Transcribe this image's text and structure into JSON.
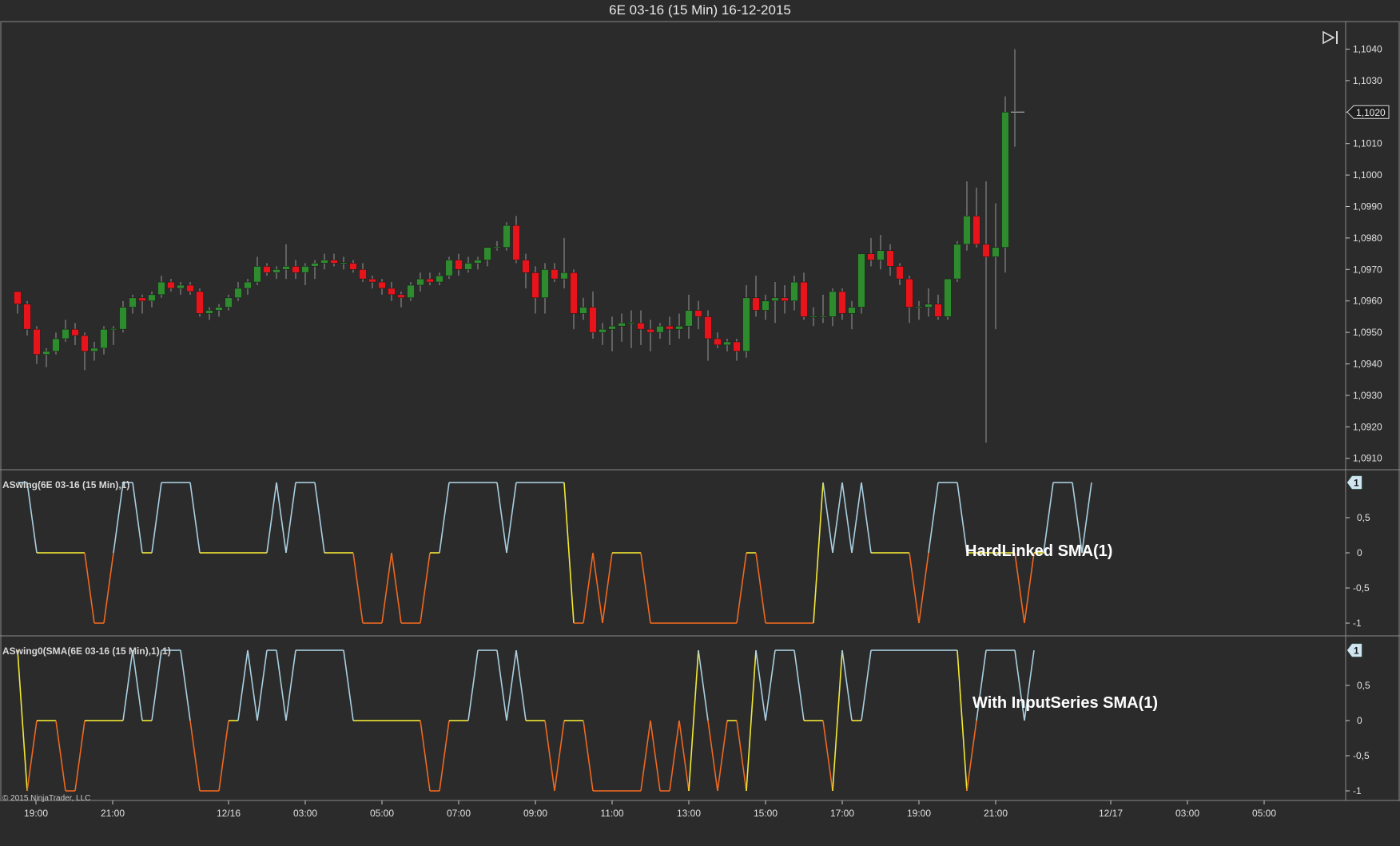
{
  "window": {
    "title": "6E 03-16 (15 Min)  16-12-2015"
  },
  "toolbar": {
    "goto_end_icon": "skip-to-end-icon"
  },
  "copyright": "© 2015 NinjaTrader, LLC",
  "colors": {
    "background": "#2b2b2b",
    "up": "#2e8b2e",
    "down": "#e8141b",
    "swing_high": "#a9cfe0",
    "swing_mid": "#f2e935",
    "swing_low": "#ee6820",
    "gridline": "#6e6e6e"
  },
  "time_axis": {
    "labels": [
      "19:00",
      "21:00",
      "12/16",
      "03:00",
      "05:00",
      "07:00",
      "09:00",
      "11:00",
      "13:00",
      "15:00",
      "17:00",
      "19:00",
      "21:00",
      "12/17",
      "03:00",
      "05:00"
    ]
  },
  "chart_data": [
    {
      "type": "candlestick",
      "title": "6E 03-16 (15 Min)  16-12-2015",
      "ylabel": "",
      "ylim": [
        1.0905,
        1.1045
      ],
      "y_ticks": [
        "1,0910",
        "1,0920",
        "1,0930",
        "1,0940",
        "1,0950",
        "1,0960",
        "1,0970",
        "1,0980",
        "1,0990",
        "1,1000",
        "1,1010",
        "1,1020",
        "1,1030",
        "1,1040"
      ],
      "last_price_label": "1,1020",
      "candles": [
        [
          1.0963,
          1.0963,
          1.0956,
          1.0959
        ],
        [
          1.0959,
          1.096,
          1.0949,
          1.0951
        ],
        [
          1.0951,
          1.0952,
          1.094,
          1.0943
        ],
        [
          1.0943,
          1.0945,
          1.0939,
          1.0944
        ],
        [
          1.0944,
          1.095,
          1.0943,
          1.0948
        ],
        [
          1.0948,
          1.0954,
          1.0947,
          1.0951
        ],
        [
          1.0951,
          1.0953,
          1.0946,
          1.0949
        ],
        [
          1.0949,
          1.095,
          1.0938,
          1.0944
        ],
        [
          1.0944,
          1.0947,
          1.0941,
          1.0945
        ],
        [
          1.0945,
          1.0952,
          1.0943,
          1.0951
        ],
        [
          1.0951,
          1.0952,
          1.0946,
          1.0951
        ],
        [
          1.0951,
          1.096,
          1.095,
          1.0958
        ],
        [
          1.0958,
          1.0962,
          1.0956,
          1.0961
        ],
        [
          1.0961,
          1.0962,
          1.0956,
          1.096
        ],
        [
          1.096,
          1.0963,
          1.0958,
          1.0962
        ],
        [
          1.0962,
          1.0968,
          1.0961,
          1.0966
        ],
        [
          1.0966,
          1.0967,
          1.0963,
          1.0964
        ],
        [
          1.0964,
          1.0966,
          1.0962,
          1.0965
        ],
        [
          1.0965,
          1.0966,
          1.0962,
          1.0963
        ],
        [
          1.0963,
          1.0964,
          1.0955,
          1.0956
        ],
        [
          1.0956,
          1.0958,
          1.0954,
          1.0957
        ],
        [
          1.0957,
          1.0959,
          1.0955,
          1.0958
        ],
        [
          1.0958,
          1.0962,
          1.0957,
          1.0961
        ],
        [
          1.0961,
          1.0966,
          1.096,
          1.0964
        ],
        [
          1.0964,
          1.0967,
          1.0962,
          1.0966
        ],
        [
          1.0966,
          1.0974,
          1.0965,
          1.0971
        ],
        [
          1.0971,
          1.0972,
          1.0968,
          1.0969
        ],
        [
          1.0969,
          1.0971,
          1.0967,
          1.097
        ],
        [
          1.097,
          1.0978,
          1.0967,
          1.0971
        ],
        [
          1.0971,
          1.0973,
          1.0967,
          1.0969
        ],
        [
          1.0969,
          1.0972,
          1.0965,
          1.0971
        ],
        [
          1.0971,
          1.0973,
          1.0967,
          1.0972
        ],
        [
          1.0972,
          1.0975,
          1.097,
          1.0973
        ],
        [
          1.0973,
          1.0975,
          1.0971,
          1.0972
        ],
        [
          1.0972,
          1.0974,
          1.097,
          1.0972
        ],
        [
          1.0972,
          1.0973,
          1.0969,
          1.097
        ],
        [
          1.097,
          1.0972,
          1.0966,
          1.0967
        ],
        [
          1.0967,
          1.0968,
          1.0964,
          1.0966
        ],
        [
          1.0966,
          1.0967,
          1.0962,
          1.0964
        ],
        [
          1.0964,
          1.0966,
          1.096,
          1.0962
        ],
        [
          1.0962,
          1.0963,
          1.0958,
          1.0961
        ],
        [
          1.0961,
          1.0966,
          1.096,
          1.0965
        ],
        [
          1.0965,
          1.0969,
          1.0963,
          1.0967
        ],
        [
          1.0967,
          1.0969,
          1.0965,
          1.0966
        ],
        [
          1.0966,
          1.0969,
          1.0965,
          1.0968
        ],
        [
          1.0968,
          1.0974,
          1.0967,
          1.0973
        ],
        [
          1.0973,
          1.0975,
          1.0968,
          1.097
        ],
        [
          1.097,
          1.0974,
          1.0969,
          1.0972
        ],
        [
          1.0972,
          1.0974,
          1.097,
          1.0973
        ],
        [
          1.0973,
          1.0976,
          1.0971,
          1.0977
        ],
        [
          1.0977,
          1.0979,
          1.0976,
          1.0977
        ],
        [
          1.0977,
          1.0985,
          1.0976,
          1.0984
        ],
        [
          1.0984,
          1.0987,
          1.0972,
          1.0973
        ],
        [
          1.0973,
          1.0975,
          1.0964,
          1.0969
        ],
        [
          1.0969,
          1.0971,
          1.0956,
          1.0961
        ],
        [
          1.0961,
          1.0972,
          1.0956,
          1.097
        ],
        [
          1.097,
          1.0972,
          1.0966,
          1.0967
        ],
        [
          1.0967,
          1.098,
          1.0964,
          1.0969
        ],
        [
          1.0969,
          1.097,
          1.0951,
          1.0956
        ],
        [
          1.0956,
          1.0961,
          1.0954,
          1.0958
        ],
        [
          1.0958,
          1.0963,
          1.0948,
          1.095
        ],
        [
          1.095,
          1.0953,
          1.0946,
          1.0951
        ],
        [
          1.0951,
          1.0955,
          1.0944,
          1.0952
        ],
        [
          1.0952,
          1.0956,
          1.0947,
          1.0953
        ],
        [
          1.0953,
          1.0957,
          1.0945,
          1.0953
        ],
        [
          1.0953,
          1.0957,
          1.0946,
          1.0951
        ],
        [
          1.0951,
          1.0954,
          1.0944,
          1.095
        ],
        [
          1.095,
          1.0953,
          1.0948,
          1.0952
        ],
        [
          1.0952,
          1.0955,
          1.0946,
          1.0951
        ],
        [
          1.0951,
          1.0956,
          1.0948,
          1.0952
        ],
        [
          1.0952,
          1.0962,
          1.0948,
          1.0957
        ],
        [
          1.0957,
          1.096,
          1.0951,
          1.0955
        ],
        [
          1.0955,
          1.0957,
          1.0941,
          1.0948
        ],
        [
          1.0948,
          1.095,
          1.0945,
          1.0946
        ],
        [
          1.0946,
          1.0948,
          1.0944,
          1.0947
        ],
        [
          1.0947,
          1.0948,
          1.0941,
          1.0944
        ],
        [
          1.0944,
          1.0965,
          1.0942,
          1.0961
        ],
        [
          1.0961,
          1.0968,
          1.0955,
          1.0957
        ],
        [
          1.0957,
          1.0962,
          1.0954,
          1.096
        ],
        [
          1.096,
          1.0966,
          1.0953,
          1.0961
        ],
        [
          1.0961,
          1.0965,
          1.0956,
          1.096
        ],
        [
          1.096,
          1.0968,
          1.0957,
          1.0966
        ],
        [
          1.0966,
          1.0969,
          1.0954,
          1.0955
        ],
        [
          1.0955,
          1.0958,
          1.0952,
          1.0955
        ],
        [
          1.0955,
          1.0962,
          1.0953,
          1.0955
        ],
        [
          1.0955,
          1.0964,
          1.0952,
          1.0963
        ],
        [
          1.0963,
          1.0964,
          1.0954,
          1.0956
        ],
        [
          1.0956,
          1.096,
          1.0951,
          1.0958
        ],
        [
          1.0958,
          1.0975,
          1.0956,
          1.0975
        ],
        [
          1.0975,
          1.098,
          1.0971,
          1.0973
        ],
        [
          1.0973,
          1.0981,
          1.097,
          1.0976
        ],
        [
          1.0976,
          1.0978,
          1.0968,
          1.0971
        ],
        [
          1.0971,
          1.0972,
          1.0965,
          1.0967
        ],
        [
          1.0967,
          1.0968,
          1.0953,
          1.0958
        ],
        [
          1.0958,
          1.096,
          1.0954,
          1.0958
        ],
        [
          1.0958,
          1.0964,
          1.0955,
          1.0959
        ],
        [
          1.0959,
          1.0962,
          1.0954,
          1.0955
        ],
        [
          1.0955,
          1.0967,
          1.0954,
          1.0967
        ],
        [
          1.0967,
          1.0979,
          1.0966,
          1.0978
        ],
        [
          1.0978,
          1.0998,
          1.0976,
          1.0987
        ],
        [
          1.0987,
          1.0996,
          1.0977,
          1.0978
        ],
        [
          1.0978,
          1.0998,
          1.0915,
          1.0974
        ],
        [
          1.0974,
          1.0991,
          1.0951,
          1.0977
        ],
        [
          1.0977,
          1.1025,
          1.0969,
          1.102
        ],
        [
          1.102,
          1.104,
          1.1009,
          1.102
        ]
      ]
    },
    {
      "type": "line",
      "title": "ASwing(6E 03-16 (15 Min),1)",
      "annotation": "HardLinked SMA(1)",
      "ylim": [
        -1.1,
        1.1
      ],
      "y_ticks": [
        "-1",
        "-0,5",
        "0",
        "0,5"
      ],
      "last_value_label": "1",
      "values": [
        1,
        1,
        0,
        0,
        0,
        0,
        0,
        0,
        -1,
        -1,
        0,
        1,
        1,
        0,
        0,
        1,
        1,
        1,
        1,
        0,
        0,
        0,
        0,
        0,
        0,
        0,
        0,
        1,
        0,
        1,
        1,
        1,
        0,
        0,
        0,
        0,
        -1,
        -1,
        -1,
        0,
        -1,
        -1,
        -1,
        0,
        0,
        1,
        1,
        1,
        1,
        1,
        1,
        0,
        1,
        1,
        1,
        1,
        1,
        1,
        -1,
        -1,
        0,
        -1,
        0,
        0,
        0,
        0,
        -1,
        -1,
        -1,
        -1,
        -1,
        -1,
        -1,
        -1,
        -1,
        -1,
        0,
        0,
        -1,
        -1,
        -1,
        -1,
        -1,
        -1,
        1,
        0,
        1,
        0,
        1,
        0,
        0,
        0,
        0,
        0,
        -1,
        0,
        1,
        1,
        1,
        0,
        0,
        0,
        0,
        0,
        0,
        -1,
        0,
        0,
        1,
        1,
        1,
        0,
        1
      ]
    },
    {
      "type": "line",
      "title": "ASwing0(SMA(6E 03-16 (15 Min),1),1)",
      "annotation": "With InputSeries SMA(1)",
      "ylim": [
        -1.1,
        1.1
      ],
      "y_ticks": [
        "-1",
        "-0,5",
        "0",
        "0,5"
      ],
      "last_value_label": "1",
      "values": [
        1,
        -1,
        0,
        0,
        0,
        -1,
        -1,
        0,
        0,
        0,
        0,
        0,
        1,
        0,
        0,
        1,
        1,
        1,
        0,
        -1,
        -1,
        -1,
        0,
        0,
        1,
        0,
        1,
        1,
        0,
        1,
        1,
        1,
        1,
        1,
        1,
        0,
        0,
        0,
        0,
        0,
        0,
        0,
        0,
        -1,
        -1,
        0,
        0,
        0,
        1,
        1,
        1,
        0,
        1,
        0,
        0,
        0,
        -1,
        0,
        0,
        0,
        -1,
        -1,
        -1,
        -1,
        -1,
        -1,
        0,
        -1,
        -1,
        0,
        -1,
        1,
        0,
        -1,
        0,
        0,
        -1,
        1,
        0,
        1,
        1,
        1,
        0,
        0,
        0,
        -1,
        1,
        0,
        0,
        1,
        1,
        1,
        1,
        1,
        1,
        1,
        1,
        1,
        1,
        -1,
        0,
        1,
        1,
        1,
        1,
        0,
        1
      ]
    }
  ]
}
